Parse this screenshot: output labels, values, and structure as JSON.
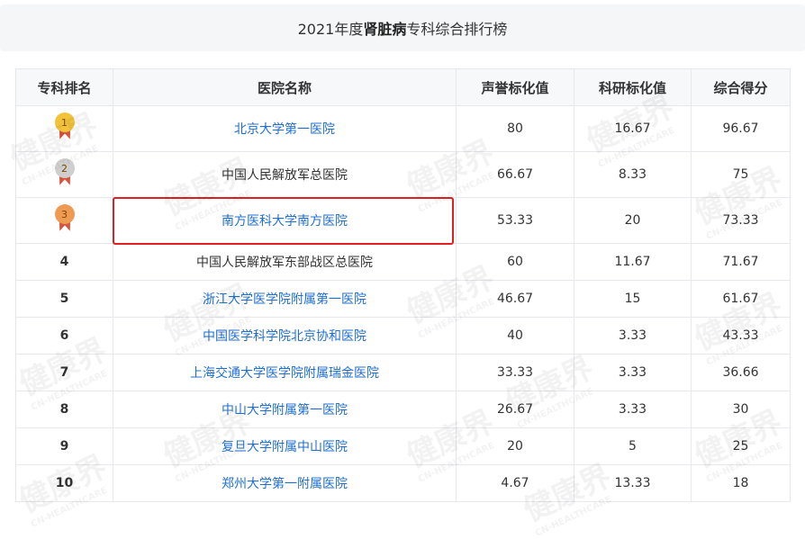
{
  "title": {
    "year_prefix": "2021年度",
    "specialty": "肾脏病",
    "suffix": "专科综合排行榜"
  },
  "columns": [
    "专科排名",
    "医院名称",
    "声誉标化值",
    "科研标化值",
    "综合得分"
  ],
  "rows": [
    {
      "rank": "1",
      "name": "北京大学第一医院",
      "reputation": "80",
      "research": "16.67",
      "total": "96.67",
      "link": true,
      "medal": "#f2c23a"
    },
    {
      "rank": "2",
      "name": "中国人民解放军总医院",
      "reputation": "66.67",
      "research": "8.33",
      "total": "75",
      "link": false,
      "medal": "#cfcfcf"
    },
    {
      "rank": "3",
      "name": "南方医科大学南方医院",
      "reputation": "53.33",
      "research": "20",
      "total": "73.33",
      "link": true,
      "medal": "#ee9a52"
    },
    {
      "rank": "4",
      "name": "中国人民解放军东部战区总医院",
      "reputation": "60",
      "research": "11.67",
      "total": "71.67",
      "link": false
    },
    {
      "rank": "5",
      "name": "浙江大学医学院附属第一医院",
      "reputation": "46.67",
      "research": "15",
      "total": "61.67",
      "link": true
    },
    {
      "rank": "6",
      "name": "中国医学科学院北京协和医院",
      "reputation": "40",
      "research": "3.33",
      "total": "43.33",
      "link": true
    },
    {
      "rank": "7",
      "name": "上海交通大学医学院附属瑞金医院",
      "reputation": "33.33",
      "research": "3.33",
      "total": "36.66",
      "link": true
    },
    {
      "rank": "8",
      "name": "中山大学附属第一医院",
      "reputation": "26.67",
      "research": "3.33",
      "total": "30",
      "link": true
    },
    {
      "rank": "9",
      "name": "复旦大学附属中山医院",
      "reputation": "20",
      "research": "5",
      "total": "25",
      "link": true
    },
    {
      "rank": "10",
      "name": "郑州大学第一附属医院",
      "reputation": "4.67",
      "research": "13.33",
      "total": "18",
      "link": true
    }
  ],
  "watermark": {
    "cn": "健康界",
    "en": "CN-HEALTHCARE"
  },
  "colors": {
    "link": "#1f6fd1",
    "highlight": "#e02020"
  }
}
